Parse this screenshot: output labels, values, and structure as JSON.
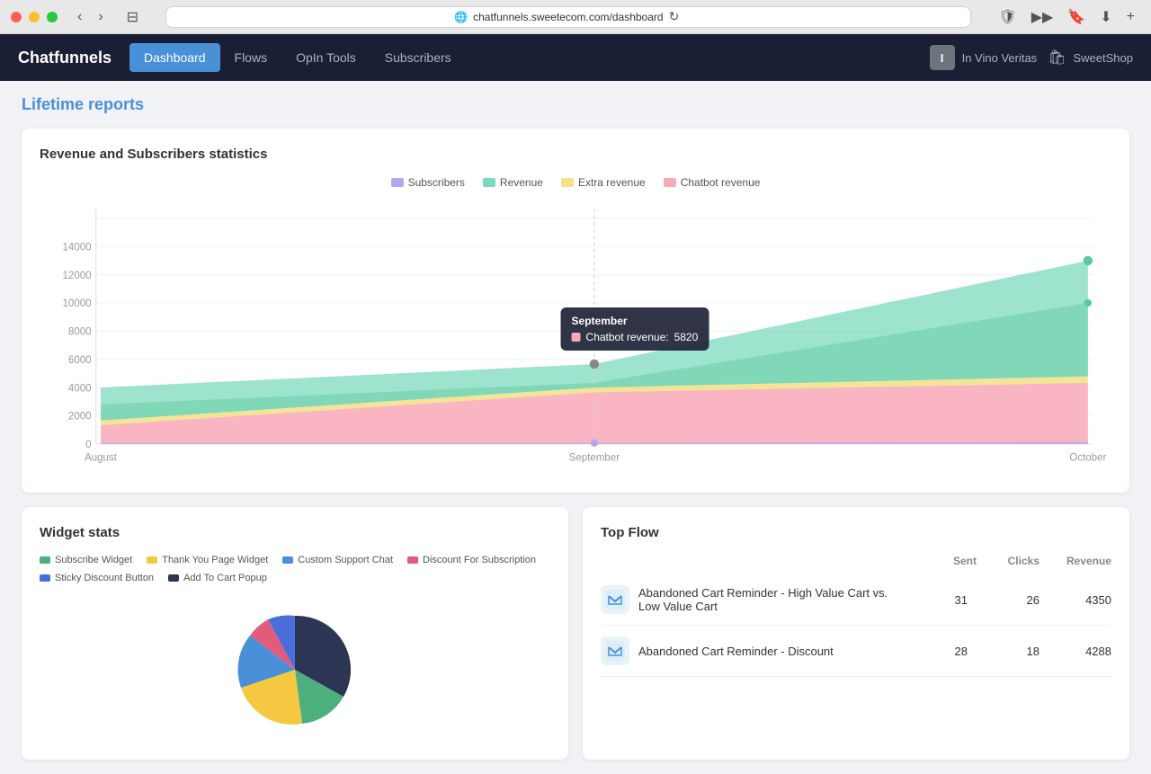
{
  "window": {
    "url": "chatfunnels.sweetecom.com/dashboard"
  },
  "nav": {
    "logo": "Chatfunnels",
    "buttons": [
      "Dashboard",
      "Flows",
      "OpIn Tools",
      "Subscribers"
    ],
    "active": "Dashboard",
    "user_icon": "I",
    "user_name": "In Vino Veritas",
    "store_name": "SweetShop"
  },
  "page": {
    "title": "Lifetime reports"
  },
  "chart": {
    "title": "Revenue and Subscribers statistics",
    "legend": [
      {
        "label": "Subscribers",
        "color": "#b3a8f0"
      },
      {
        "label": "Revenue",
        "color": "#7dd9be"
      },
      {
        "label": "Extra revenue",
        "color": "#f5e08a"
      },
      {
        "label": "Chatbot revenue",
        "color": "#f9a8b8"
      }
    ],
    "x_labels": [
      "August",
      "September",
      "October"
    ],
    "y_labels": [
      "0",
      "2000",
      "4000",
      "6000",
      "8000",
      "10000",
      "12000",
      "14000"
    ],
    "tooltip": {
      "title": "September",
      "label": "Chatbot revenue",
      "value": "5820",
      "color": "#f9a8b8"
    }
  },
  "widget_stats": {
    "title": "Widget stats",
    "legend": [
      {
        "label": "Subscribe Widget",
        "color": "#4caf7d"
      },
      {
        "label": "Thank You Page Widget",
        "color": "#f5c842"
      },
      {
        "label": "Custom Support Chat",
        "color": "#4a90d9"
      },
      {
        "label": "Discount For Subscription",
        "color": "#e05c7a"
      },
      {
        "label": "Sticky Discount Button",
        "color": "#4a6ed9"
      },
      {
        "label": "Add To Cart Popup",
        "color": "#2d3554"
      }
    ]
  },
  "top_flow": {
    "title": "Top Flow",
    "headers": [
      "Sent",
      "Clicks",
      "Revenue"
    ],
    "rows": [
      {
        "name": "Abandoned Cart Reminder - High Value Cart vs. Low Value Cart",
        "sent": 31,
        "clicks": 26,
        "revenue": 4350
      },
      {
        "name": "Abandoned Cart Reminder - Discount",
        "sent": 28,
        "clicks": 18,
        "revenue": 4288
      }
    ]
  }
}
